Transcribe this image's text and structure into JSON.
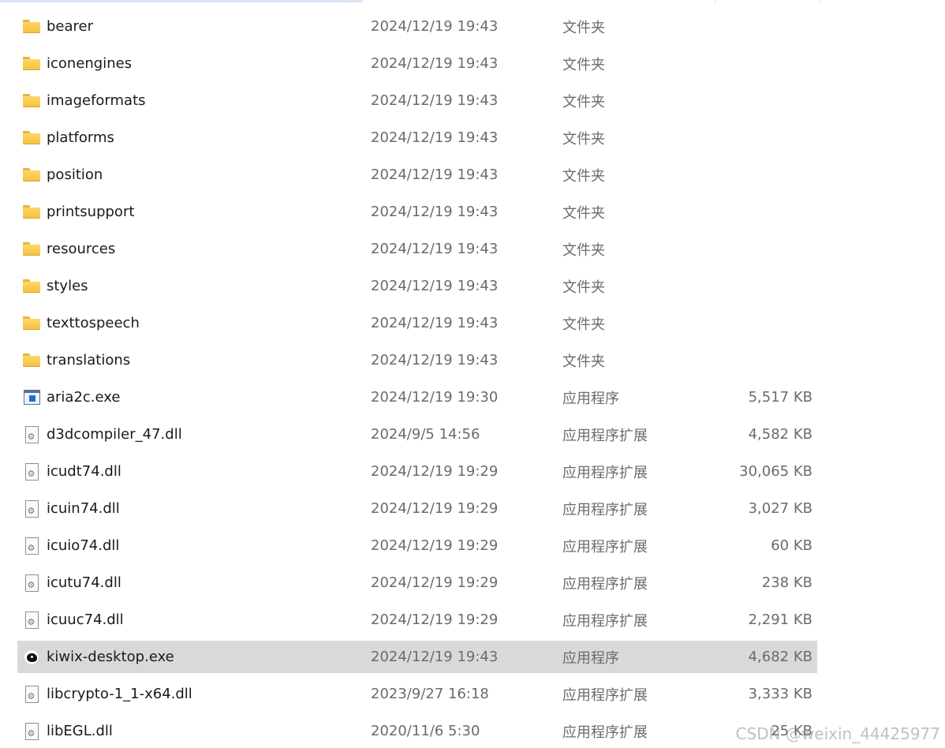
{
  "files": [
    {
      "name": "bearer",
      "date": "2024/12/19 19:43",
      "type": "文件夹",
      "size": "",
      "icon": "folder-icon"
    },
    {
      "name": "iconengines",
      "date": "2024/12/19 19:43",
      "type": "文件夹",
      "size": "",
      "icon": "folder-icon"
    },
    {
      "name": "imageformats",
      "date": "2024/12/19 19:43",
      "type": "文件夹",
      "size": "",
      "icon": "folder-icon"
    },
    {
      "name": "platforms",
      "date": "2024/12/19 19:43",
      "type": "文件夹",
      "size": "",
      "icon": "folder-icon"
    },
    {
      "name": "position",
      "date": "2024/12/19 19:43",
      "type": "文件夹",
      "size": "",
      "icon": "folder-icon"
    },
    {
      "name": "printsupport",
      "date": "2024/12/19 19:43",
      "type": "文件夹",
      "size": "",
      "icon": "folder-icon"
    },
    {
      "name": "resources",
      "date": "2024/12/19 19:43",
      "type": "文件夹",
      "size": "",
      "icon": "folder-icon"
    },
    {
      "name": "styles",
      "date": "2024/12/19 19:43",
      "type": "文件夹",
      "size": "",
      "icon": "folder-icon"
    },
    {
      "name": "texttospeech",
      "date": "2024/12/19 19:43",
      "type": "文件夹",
      "size": "",
      "icon": "folder-icon"
    },
    {
      "name": "translations",
      "date": "2024/12/19 19:43",
      "type": "文件夹",
      "size": "",
      "icon": "folder-icon"
    },
    {
      "name": "aria2c.exe",
      "date": "2024/12/19 19:30",
      "type": "应用程序",
      "size": "5,517 KB",
      "icon": "app-icon"
    },
    {
      "name": "d3dcompiler_47.dll",
      "date": "2024/9/5 14:56",
      "type": "应用程序扩展",
      "size": "4,582 KB",
      "icon": "dll-icon"
    },
    {
      "name": "icudt74.dll",
      "date": "2024/12/19 19:29",
      "type": "应用程序扩展",
      "size": "30,065 KB",
      "icon": "dll-icon"
    },
    {
      "name": "icuin74.dll",
      "date": "2024/12/19 19:29",
      "type": "应用程序扩展",
      "size": "3,027 KB",
      "icon": "dll-icon"
    },
    {
      "name": "icuio74.dll",
      "date": "2024/12/19 19:29",
      "type": "应用程序扩展",
      "size": "60 KB",
      "icon": "dll-icon"
    },
    {
      "name": "icutu74.dll",
      "date": "2024/12/19 19:29",
      "type": "应用程序扩展",
      "size": "238 KB",
      "icon": "dll-icon"
    },
    {
      "name": "icuuc74.dll",
      "date": "2024/12/19 19:29",
      "type": "应用程序扩展",
      "size": "2,291 KB",
      "icon": "dll-icon"
    },
    {
      "name": "kiwix-desktop.exe",
      "date": "2024/12/19 19:43",
      "type": "应用程序",
      "size": "4,682 KB",
      "icon": "kiwix-icon",
      "selected": true
    },
    {
      "name": "libcrypto-1_1-x64.dll",
      "date": "2023/9/27 16:18",
      "type": "应用程序扩展",
      "size": "3,333 KB",
      "icon": "dll-icon"
    },
    {
      "name": "libEGL.dll",
      "date": "2020/11/6 5:30",
      "type": "应用程序扩展",
      "size": "25 KB",
      "icon": "dll-icon"
    }
  ],
  "watermark": "CSDN @weixin_44425977",
  "colors": {
    "selection": "#d9d9d9",
    "folder": "#f4c242",
    "text_primary": "#1a1a1a",
    "text_secondary": "#6b6b6b"
  }
}
